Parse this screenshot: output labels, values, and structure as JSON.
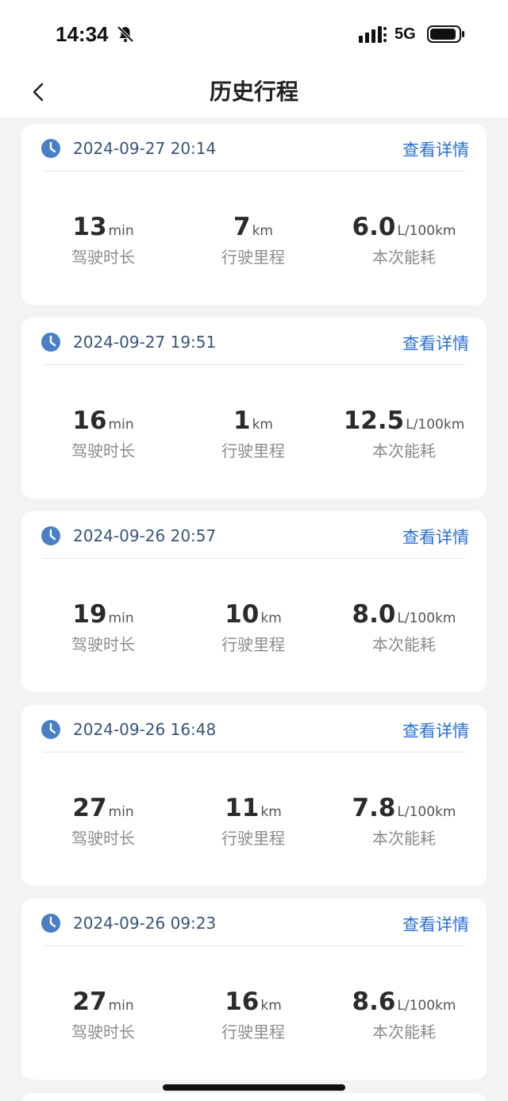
{
  "status_bar": {
    "time": "14:34",
    "network": "5G",
    "icons": [
      "bell-off-icon",
      "signal-icon",
      "battery-icon"
    ]
  },
  "nav": {
    "title": "历史行程",
    "back_icon": "chevron-left-icon"
  },
  "colors": {
    "accent_link": "#2a6fd6",
    "clock_icon": "#4a7fc8",
    "datetime_text": "#3a5378",
    "background": "#f2f3f5"
  },
  "trips": [
    {
      "datetime": "2024-09-27 20:14",
      "detail_label": "查看详情",
      "duration": {
        "value": "13",
        "unit": "min",
        "label": "驾驶时长"
      },
      "distance": {
        "value": "7",
        "unit": "km",
        "label": "行驶里程"
      },
      "consumption": {
        "value": "6.0",
        "unit": "L/100km",
        "label": "本次能耗"
      }
    },
    {
      "datetime": "2024-09-27 19:51",
      "detail_label": "查看详情",
      "duration": {
        "value": "16",
        "unit": "min",
        "label": "驾驶时长"
      },
      "distance": {
        "value": "1",
        "unit": "km",
        "label": "行驶里程"
      },
      "consumption": {
        "value": "12.5",
        "unit": "L/100km",
        "label": "本次能耗"
      }
    },
    {
      "datetime": "2024-09-26 20:57",
      "detail_label": "查看详情",
      "duration": {
        "value": "19",
        "unit": "min",
        "label": "驾驶时长"
      },
      "distance": {
        "value": "10",
        "unit": "km",
        "label": "行驶里程"
      },
      "consumption": {
        "value": "8.0",
        "unit": "L/100km",
        "label": "本次能耗"
      }
    },
    {
      "datetime": "2024-09-26 16:48",
      "detail_label": "查看详情",
      "duration": {
        "value": "27",
        "unit": "min",
        "label": "驾驶时长"
      },
      "distance": {
        "value": "11",
        "unit": "km",
        "label": "行驶里程"
      },
      "consumption": {
        "value": "7.8",
        "unit": "L/100km",
        "label": "本次能耗"
      }
    },
    {
      "datetime": "2024-09-26 09:23",
      "detail_label": "查看详情",
      "duration": {
        "value": "27",
        "unit": "min",
        "label": "驾驶时长"
      },
      "distance": {
        "value": "16",
        "unit": "km",
        "label": "行驶里程"
      },
      "consumption": {
        "value": "8.6",
        "unit": "L/100km",
        "label": "本次能耗"
      }
    }
  ]
}
